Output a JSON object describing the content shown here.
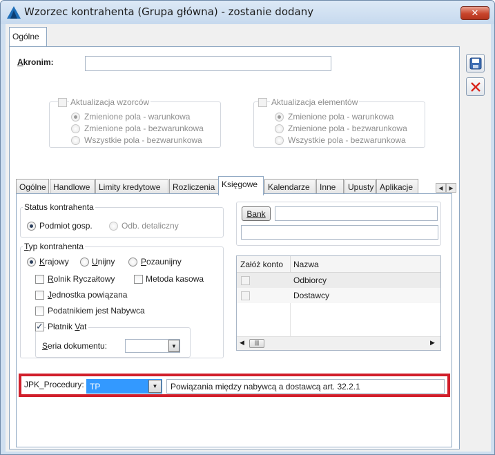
{
  "window": {
    "title": "Wzorzec kontrahenta (Grupa główna) - zostanie dodany",
    "close_glyph": "✕"
  },
  "top_tab": {
    "label": "Ogólne"
  },
  "akronim": {
    "label_first": "A",
    "label_rest": "kronim:",
    "value": ""
  },
  "update_templates": {
    "title": "Aktualizacja wzorców",
    "options": [
      "Zmienione pola - warunkowa",
      "Zmienione pola - bezwarunkowa",
      "Wszystkie pola - bezwarunkowa"
    ],
    "selected": 0
  },
  "update_elements": {
    "title": "Aktualizacja elementów",
    "options": [
      "Zmienione pola - warunkowa",
      "Zmienione pola - bezwarunkowa",
      "Wszystkie pola - bezwarunkowa"
    ],
    "selected": 0
  },
  "tabs": [
    "Ogólne",
    "Handlowe",
    "Limity kredytowe",
    "Rozliczenia",
    "Księgowe",
    "Kalendarze",
    "Inne",
    "Upusty",
    "Aplikacje"
  ],
  "active_tab": "Księgowe",
  "status": {
    "title": "Status kontrahenta",
    "options": [
      "Podmiot gosp.",
      "Odb. detaliczny"
    ]
  },
  "typ": {
    "title_first": "T",
    "title_rest": "yp kontrahenta",
    "krajowy_first": "K",
    "krajowy_rest": "rajowy",
    "unijny_first": "U",
    "unijny_rest": "nijny",
    "pozaunijny_first": "P",
    "pozaunijny_rest": "ozaunijny",
    "rolnik_first": "R",
    "rolnik_rest": "olnik Ryczałtowy",
    "metoda": "Metoda kasowa",
    "jednostka_first": "J",
    "jednostka_rest": "ednostka powiązana",
    "nabywca": "Podatnikiem jest Nabywca",
    "platnik_pre": "Płatnik ",
    "platnik_u": "V",
    "platnik_post": "at",
    "seria_first": "S",
    "seria_rest": "eria dokumentu:",
    "seria_value": ""
  },
  "bank": {
    "button": "Bank",
    "value1": "",
    "value2": ""
  },
  "accounts_grid": {
    "headers": [
      "Załóż konto",
      "Nazwa"
    ],
    "rows": [
      "Odbiorcy",
      "Dostawcy"
    ]
  },
  "jpk": {
    "label": "JPK_Procedury:",
    "selected": "TP",
    "description": "Powiązania między nabywcą a dostawcą art. 32.2.1"
  },
  "colors": {
    "highlight": "#d11f2b",
    "selection": "#3399ff"
  }
}
